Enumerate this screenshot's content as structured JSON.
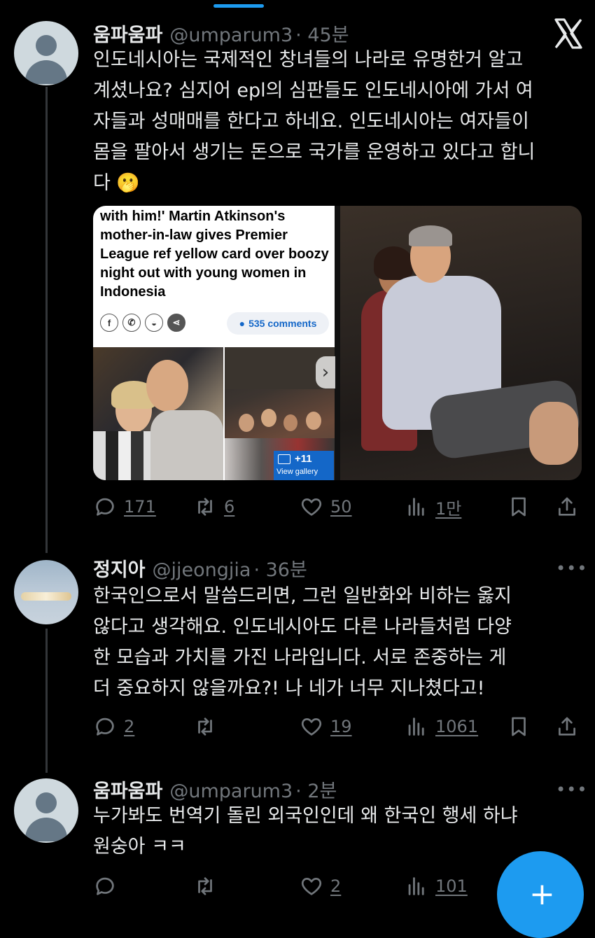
{
  "tweets": [
    {
      "name": "움파움파",
      "handle": "@umparum3",
      "time": "· 45분",
      "text_lines": [
        "인도네시아는 국제적인 창녀들의 나라로 유명한거 알고",
        "계셨나요? 심지어 epl의 심판들도 인도네시아에 가서 여",
        "자들과 성매매를 한다고 하네요. 인도네시아는 여자들이",
        "몸을 팔아서 생기는 돈으로 국가를 운영하고 있다고 합니",
        "다 🫢"
      ],
      "replies": "171",
      "retweets": "6",
      "likes": "50",
      "views": "1만"
    },
    {
      "name": "정지아",
      "handle": "@jjeongjia",
      "time": "· 36분",
      "text_lines": [
        "한국인으로서 말씀드리면, 그런 일반화와 비하는 옳지",
        "않다고 생각해요. 인도네시아도 다른 나라들처럼 다양",
        "한 모습과 가치를 가진 나라입니다. 서로 존중하는 게",
        "더 중요하지 않을까요?! 나 네가 너무 지나쳤다고!"
      ],
      "replies": "2",
      "retweets": "",
      "likes": "19",
      "views": "1061"
    },
    {
      "name": "움파움파",
      "handle": "@umparum3",
      "time": "· 2분",
      "text_lines": [
        "누가봐도 번역기 돌린 외국인인데 왜 한국인 행세 하냐",
        "원숭아 ㅋㅋ"
      ],
      "replies": "",
      "retweets": "",
      "likes": "2",
      "views": "101"
    }
  ],
  "media": {
    "headline": "with him!' Martin Atkinson's mother-in-law gives Premier League ref yellow card over boozy night out with young women in Indonesia",
    "comments": "535 comments",
    "gallery_count": "+11",
    "gallery_label": "View gallery",
    "share_icons": [
      "facebook-icon",
      "whatsapp-icon",
      "snapchat-icon",
      "share-icon"
    ]
  },
  "more_glyph": "•••",
  "fab_glyph": "+",
  "colors": {
    "background": "#000000",
    "text": "#e7e9ea",
    "secondary": "#71767b",
    "accent": "#1d9bf0"
  }
}
